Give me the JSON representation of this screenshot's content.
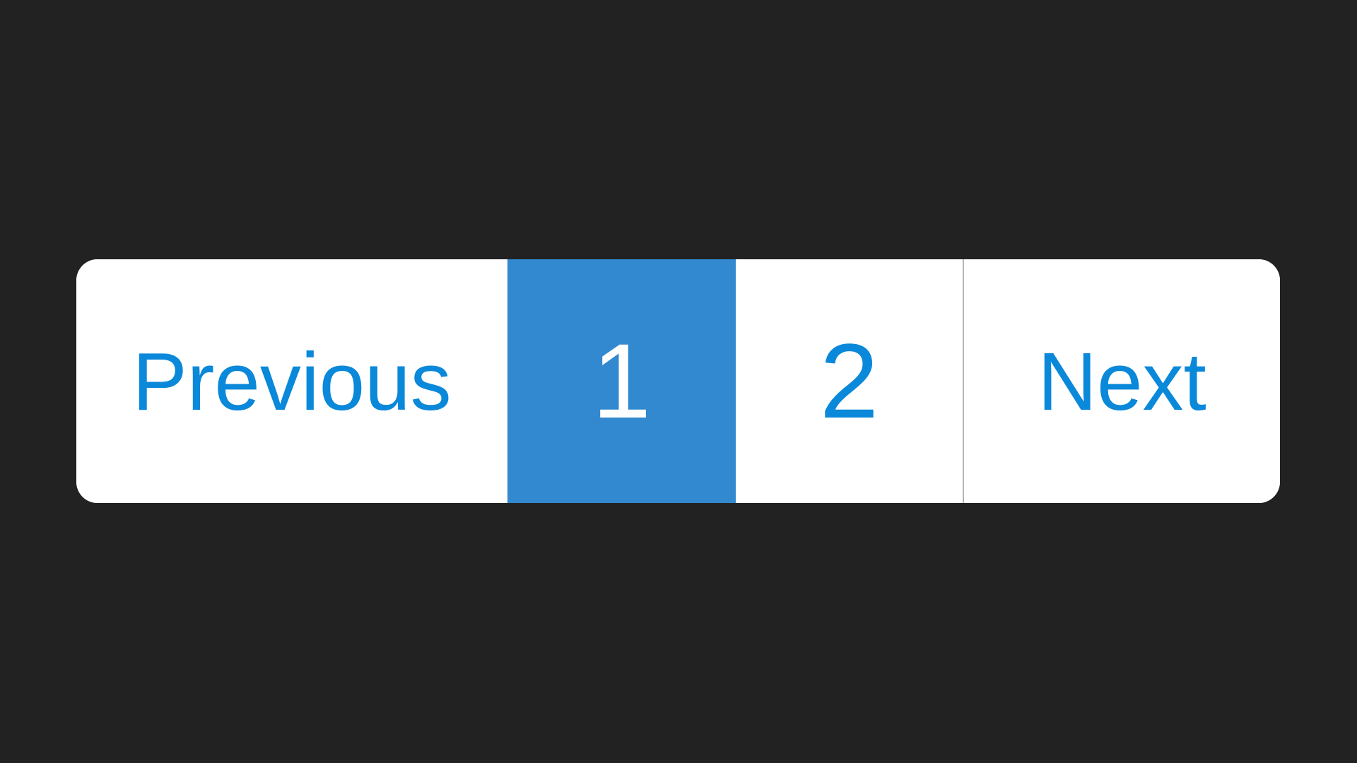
{
  "pagination": {
    "previous_label": "Previous",
    "pages": [
      "1",
      "2"
    ],
    "current_page": "1",
    "next_label": "Next"
  },
  "colors": {
    "background": "#222222",
    "bar": "#ffffff",
    "link_text": "#0a88d9",
    "active_fill": "#3389cf",
    "active_text": "#ffffff",
    "divider": "#b5b5b5"
  }
}
